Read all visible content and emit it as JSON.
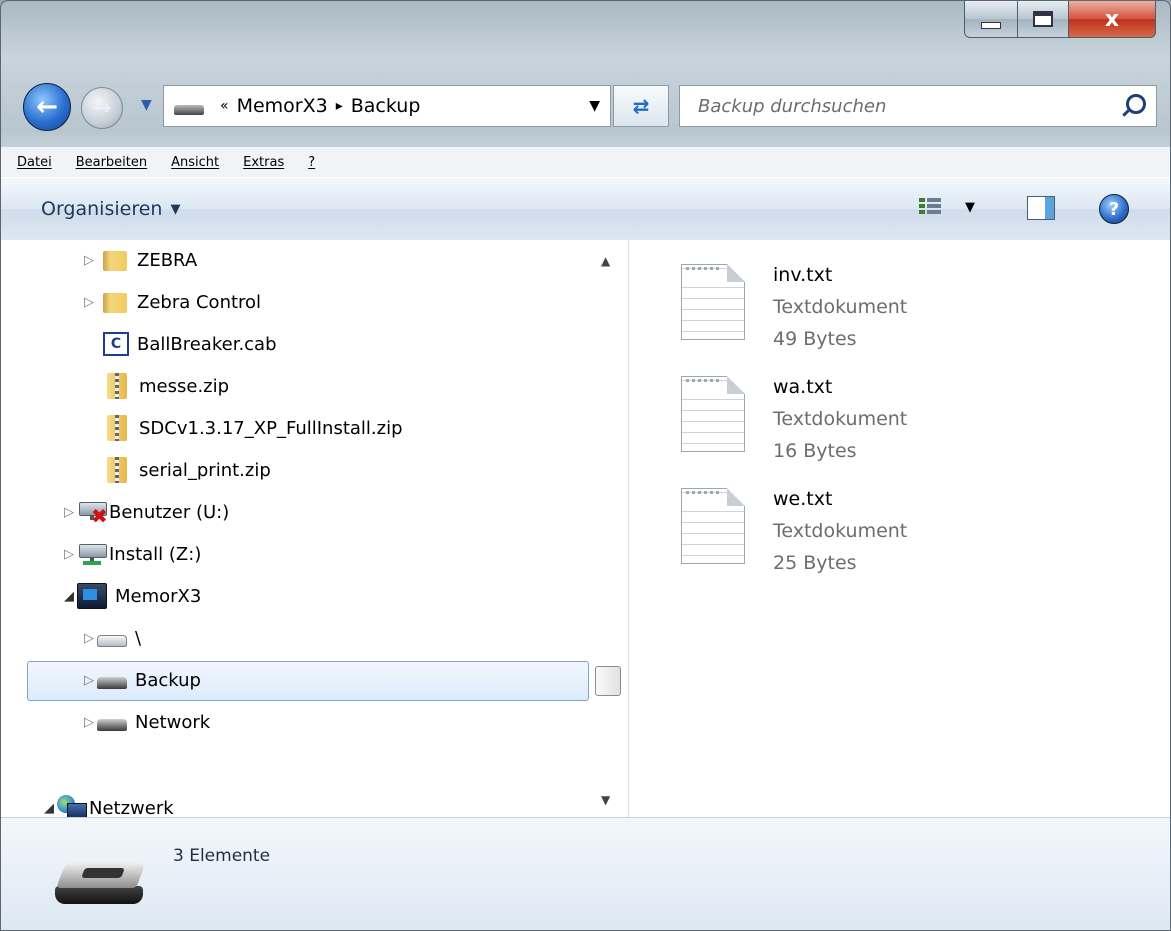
{
  "window": {
    "caption_buttons": {
      "minimize_icon": "minimize-icon",
      "maximize_icon": "maximize-icon",
      "close_label": "x"
    }
  },
  "nav": {
    "back_icon": "back-arrow-icon",
    "forward_icon": "forward-arrow-icon",
    "address_crumbs": [
      "MemorX3",
      "Backup"
    ],
    "address_prefix": "«",
    "crumb_separator": "▸",
    "search_placeholder": "Backup durchsuchen"
  },
  "menu": {
    "items": [
      "Datei",
      "Bearbeiten",
      "Ansicht",
      "Extras",
      "?"
    ]
  },
  "command_bar": {
    "organize_label": "Organisieren"
  },
  "tree": {
    "items": [
      {
        "label": "ZEBRA",
        "icon": "folder-icon",
        "expandable": true
      },
      {
        "label": "Zebra Control",
        "icon": "folder-icon",
        "expandable": true
      },
      {
        "label": "BallBreaker.cab",
        "icon": "cab-file-icon",
        "expandable": false
      },
      {
        "label": "messe.zip",
        "icon": "zip-icon",
        "expandable": false
      },
      {
        "label": "SDCv1.3.17_XP_FullInstall.zip",
        "icon": "zip-icon",
        "expandable": false
      },
      {
        "label": "serial_print.zip",
        "icon": "zip-icon",
        "expandable": false
      },
      {
        "label": "Benutzer (U:)",
        "icon": "disconnected-network-drive-icon",
        "expandable": true
      },
      {
        "label": "Install (Z:)",
        "icon": "network-drive-icon",
        "expandable": true
      },
      {
        "label": "MemorX3",
        "icon": "device-icon",
        "expandable": true,
        "expanded": true
      },
      {
        "label": "\\",
        "icon": "drive-icon",
        "expandable": true
      },
      {
        "label": "Backup",
        "icon": "drive-icon",
        "expandable": true,
        "selected": true
      },
      {
        "label": "Network",
        "icon": "drive-icon",
        "expandable": true
      },
      {
        "label": "Netzwerk",
        "icon": "network-globe-icon",
        "expandable": true,
        "expanded": true
      }
    ]
  },
  "files": [
    {
      "name": "inv.txt",
      "type": "Textdokument",
      "size": "49 Bytes"
    },
    {
      "name": "wa.txt",
      "type": "Textdokument",
      "size": "16 Bytes"
    },
    {
      "name": "we.txt",
      "type": "Textdokument",
      "size": "25 Bytes"
    }
  ],
  "details": {
    "count": "3 Elemente"
  }
}
